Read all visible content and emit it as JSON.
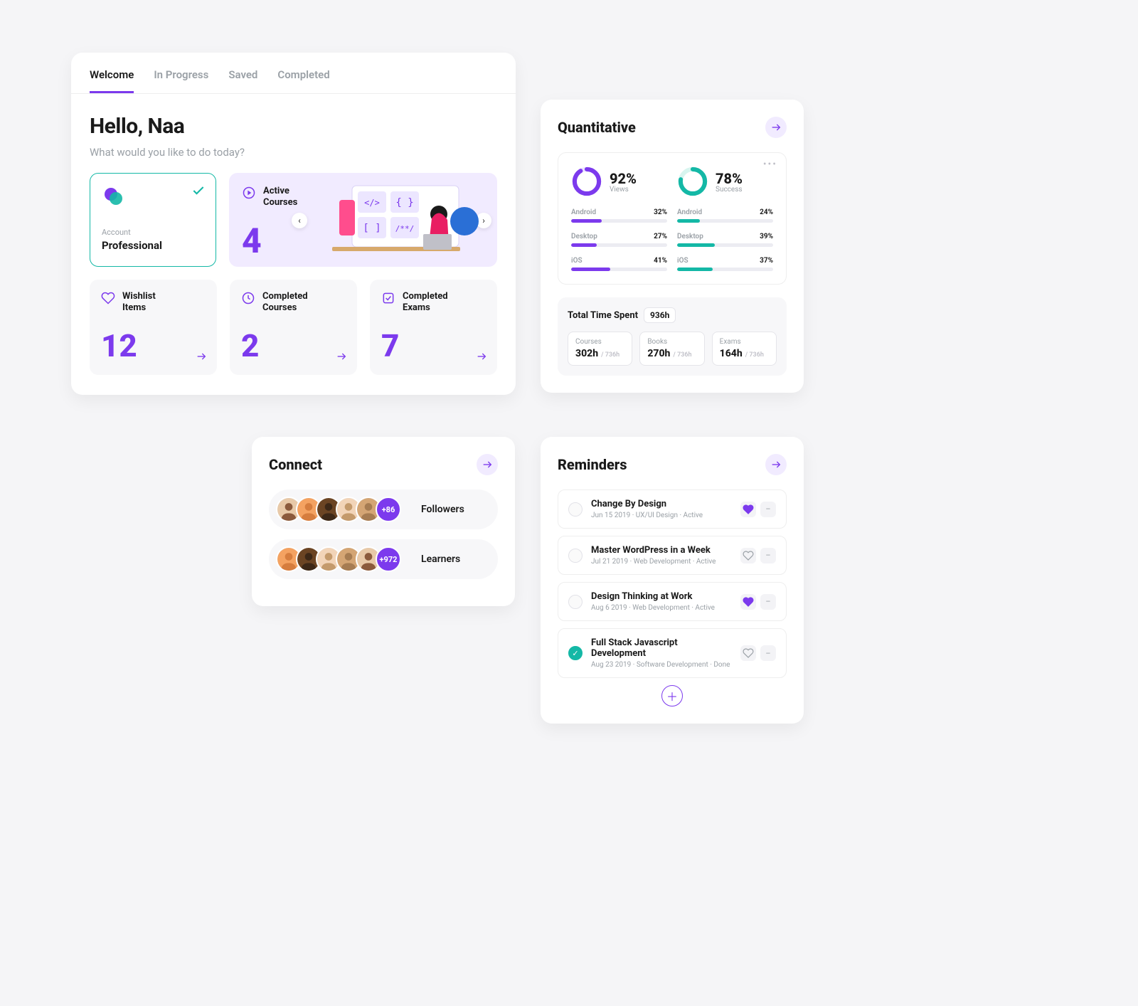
{
  "colors": {
    "purple": "#7c3aed",
    "teal": "#14b8a6"
  },
  "welcome": {
    "tabs": [
      "Welcome",
      "In Progress",
      "Saved",
      "Completed"
    ],
    "active_tab": 0,
    "greeting": "Hello, Naa",
    "subtitle": "What would you like to do today?",
    "account": {
      "label": "Account",
      "value": "Professional"
    },
    "active_courses": {
      "title_l1": "Active",
      "title_l2": "Courses",
      "value": "4"
    },
    "tiles": [
      {
        "title_l1": "Wishlist",
        "title_l2": "Items",
        "value": "12",
        "icon": "heart"
      },
      {
        "title_l1": "Completed",
        "title_l2": "Courses",
        "value": "2",
        "icon": "clock"
      },
      {
        "title_l1": "Completed",
        "title_l2": "Exams",
        "value": "7",
        "icon": "check-square"
      }
    ]
  },
  "quant": {
    "title": "Quantitative",
    "donuts": [
      {
        "percent": "92%",
        "label": "Views",
        "value": 92,
        "color": "#7c3aed"
      },
      {
        "percent": "78%",
        "label": "Success",
        "value": 78,
        "color": "#14b8a6"
      }
    ],
    "cols": [
      {
        "rows": [
          {
            "name": "Android",
            "value": "32%",
            "pct": 32
          },
          {
            "name": "Desktop",
            "value": "27%",
            "pct": 27
          },
          {
            "name": "iOS",
            "value": "41%",
            "pct": 41
          }
        ],
        "color": "#7c3aed"
      },
      {
        "rows": [
          {
            "name": "Android",
            "value": "24%",
            "pct": 24
          },
          {
            "name": "Desktop",
            "value": "39%",
            "pct": 39
          },
          {
            "name": "iOS",
            "value": "37%",
            "pct": 37
          }
        ],
        "color": "#14b8a6"
      }
    ],
    "time": {
      "label": "Total Time Spent",
      "total": "936h",
      "cells": [
        {
          "cat": "Courses",
          "val": "302h",
          "sub": "/ 736h"
        },
        {
          "cat": "Books",
          "val": "270h",
          "sub": "/ 736h"
        },
        {
          "cat": "Exams",
          "val": "164h",
          "sub": "/ 736h"
        }
      ]
    }
  },
  "connect": {
    "title": "Connect",
    "rows": [
      {
        "more": "+86",
        "label": "Followers"
      },
      {
        "more": "+972",
        "label": "Learners"
      }
    ]
  },
  "reminders": {
    "title": "Reminders",
    "items": [
      {
        "title": "Change By Design",
        "sub": "Jun 15 2019 · UX/UI Design · Active",
        "liked": true,
        "done": false
      },
      {
        "title": "Master WordPress in a Week",
        "sub": "Jul 21 2019 · Web Development · Active",
        "liked": false,
        "done": false
      },
      {
        "title": "Design Thinking at Work",
        "sub": "Aug 6 2019 · Web Development · Active",
        "liked": true,
        "done": false
      },
      {
        "title": "Full Stack Javascript Development",
        "sub": "Aug 23 2019 · Software Development · Done",
        "liked": false,
        "done": true
      }
    ]
  },
  "chart_data": {
    "donuts": [
      {
        "name": "Views",
        "value": 92,
        "max": 100,
        "color": "#7c3aed"
      },
      {
        "name": "Success",
        "value": 78,
        "max": 100,
        "color": "#14b8a6"
      }
    ],
    "bars": [
      {
        "group": "Views",
        "color": "#7c3aed",
        "series": [
          {
            "name": "Android",
            "value": 32
          },
          {
            "name": "Desktop",
            "value": 27
          },
          {
            "name": "iOS",
            "value": 41
          }
        ]
      },
      {
        "group": "Success",
        "color": "#14b8a6",
        "series": [
          {
            "name": "Android",
            "value": 24
          },
          {
            "name": "Desktop",
            "value": 39
          },
          {
            "name": "iOS",
            "value": 37
          }
        ]
      }
    ],
    "type": "bar"
  }
}
